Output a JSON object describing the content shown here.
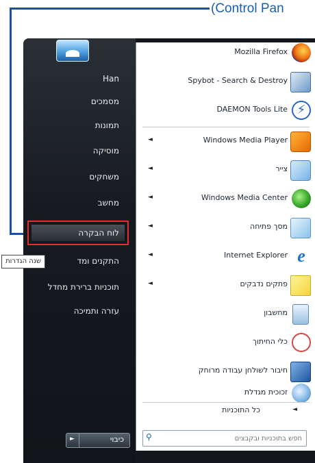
{
  "callout": {
    "label": "(Control Pan"
  },
  "left_pane": {
    "user": "Han",
    "items": [
      {
        "label": "מסמכים"
      },
      {
        "label": "תמונות"
      },
      {
        "label": "מוסיקה"
      },
      {
        "label": "משחקים"
      },
      {
        "label": "מחשב"
      },
      {
        "label": "לוח הבקרה"
      },
      {
        "label": "התקנים ומד"
      },
      {
        "label": "תוכניות ברירת מחדל"
      },
      {
        "label": "עזרה ותמיכה"
      }
    ],
    "tooltip": "שנה הגדרות",
    "shutdown_label": "כיבוי"
  },
  "right_pane": {
    "pinned": [
      {
        "name": "Mozilla Firefox",
        "icon": "firefox-icon",
        "submenu": false
      },
      {
        "name": "Spybot - Search & Destroy",
        "icon": "spybot-icon",
        "submenu": false
      },
      {
        "name": "DAEMON Tools Lite",
        "icon": "daemon-tools-icon",
        "submenu": false
      }
    ],
    "recent": [
      {
        "name": "Windows Media Player",
        "icon": "media-player-icon",
        "submenu": true
      },
      {
        "name": "צייר",
        "icon": "paint-icon",
        "submenu": true
      },
      {
        "name": "Windows Media Center",
        "icon": "media-center-icon",
        "submenu": true
      },
      {
        "name": "מסך פתיחה",
        "icon": "getting-started-icon",
        "submenu": true
      },
      {
        "name": "Internet Explorer",
        "icon": "internet-explorer-icon",
        "submenu": true
      },
      {
        "name": "פתקים נדבקים",
        "icon": "sticky-notes-icon",
        "submenu": true
      },
      {
        "name": "מחשבון",
        "icon": "calculator-icon",
        "submenu": false
      },
      {
        "name": "כלי החיתוך",
        "icon": "snipping-tool-icon",
        "submenu": false
      },
      {
        "name": "חיבור לשולחן עבודה מרוחק",
        "icon": "remote-desktop-icon",
        "submenu": false
      },
      {
        "name": "זכוכית מגדלת",
        "icon": "magnifier-icon",
        "submenu": false
      }
    ],
    "all_programs": "כל התוכניות",
    "search_placeholder": "חפש בתוכניות ובקבצים"
  },
  "colors": {
    "accent": "#1a4fa0",
    "highlight_border": "#e52d2d",
    "menu_dark": "#14181d"
  }
}
